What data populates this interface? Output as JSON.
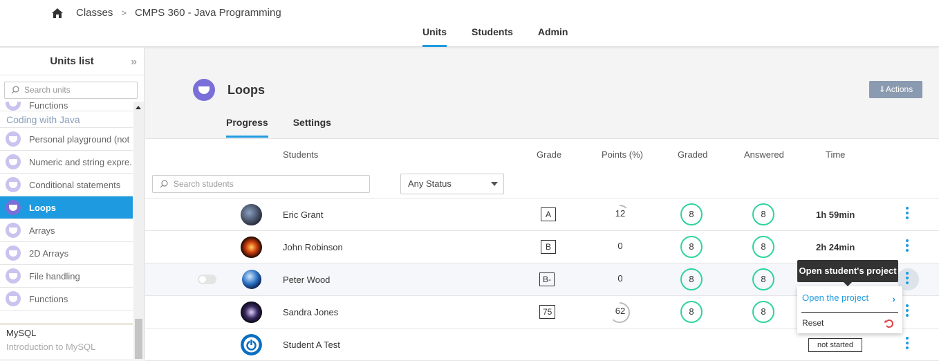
{
  "breadcrumb": {
    "items": [
      "Classes",
      "CMPS 360 - Java Programming"
    ],
    "separator": ">"
  },
  "top_tabs": [
    {
      "label": "Units",
      "active": true
    },
    {
      "label": "Students",
      "active": false
    },
    {
      "label": "Admin",
      "active": false
    }
  ],
  "sidebar": {
    "title": "Units list",
    "search_placeholder": "Search units",
    "items_top": {
      "label": "Functions"
    },
    "section_java": "Coding with Java",
    "items": [
      {
        "label": "Personal playground (not"
      },
      {
        "label": "Numeric and string expre..."
      },
      {
        "label": "Conditional statements"
      },
      {
        "label": "Loops",
        "active": true
      },
      {
        "label": "Arrays"
      },
      {
        "label": "2D Arrays"
      },
      {
        "label": "File handling"
      },
      {
        "label": "Functions"
      }
    ],
    "section_mysql": "MySQL",
    "section_next": "Introduction to MySQL"
  },
  "unit": {
    "title": "Loops",
    "actions_label": "⇓Actions"
  },
  "sub_tabs": [
    {
      "label": "Progress",
      "active": true
    },
    {
      "label": "Settings",
      "active": false
    }
  ],
  "table": {
    "headers": {
      "students": "Students",
      "grade": "Grade",
      "points": "Points (%)",
      "graded": "Graded",
      "answered": "Answered",
      "time": "Time"
    },
    "search_placeholder": "Search students",
    "status_filter": "Any Status",
    "rows": [
      {
        "name": "Eric Grant",
        "grade": "A",
        "points": "12",
        "points_pct": 12,
        "graded": "8",
        "answered": "8",
        "time": "1h 59min"
      },
      {
        "name": "John Robinson",
        "grade": "B",
        "points": "0",
        "points_pct": 0,
        "graded": "8",
        "answered": "8",
        "time": "2h 24min"
      },
      {
        "name": "Peter Wood",
        "grade": "B-",
        "points": "0",
        "points_pct": 0,
        "graded": "8",
        "answered": "8",
        "time": ""
      },
      {
        "name": "Sandra Jones",
        "grade": "75",
        "points": "62",
        "points_pct": 62,
        "graded": "8",
        "answered": "8",
        "time": ""
      },
      {
        "name": "Student A Test",
        "grade": "",
        "points": "",
        "graded": "",
        "answered": "",
        "status": "not started"
      }
    ]
  },
  "tooltip": "Open student's project",
  "context_menu": {
    "open_label": "Open the project",
    "reset_label": "Reset"
  },
  "colors": {
    "accent": "#1e9be0",
    "ring": "#2ed3a0",
    "unit_icon": "#7a6fd8",
    "actions": "#8a9ab0"
  }
}
